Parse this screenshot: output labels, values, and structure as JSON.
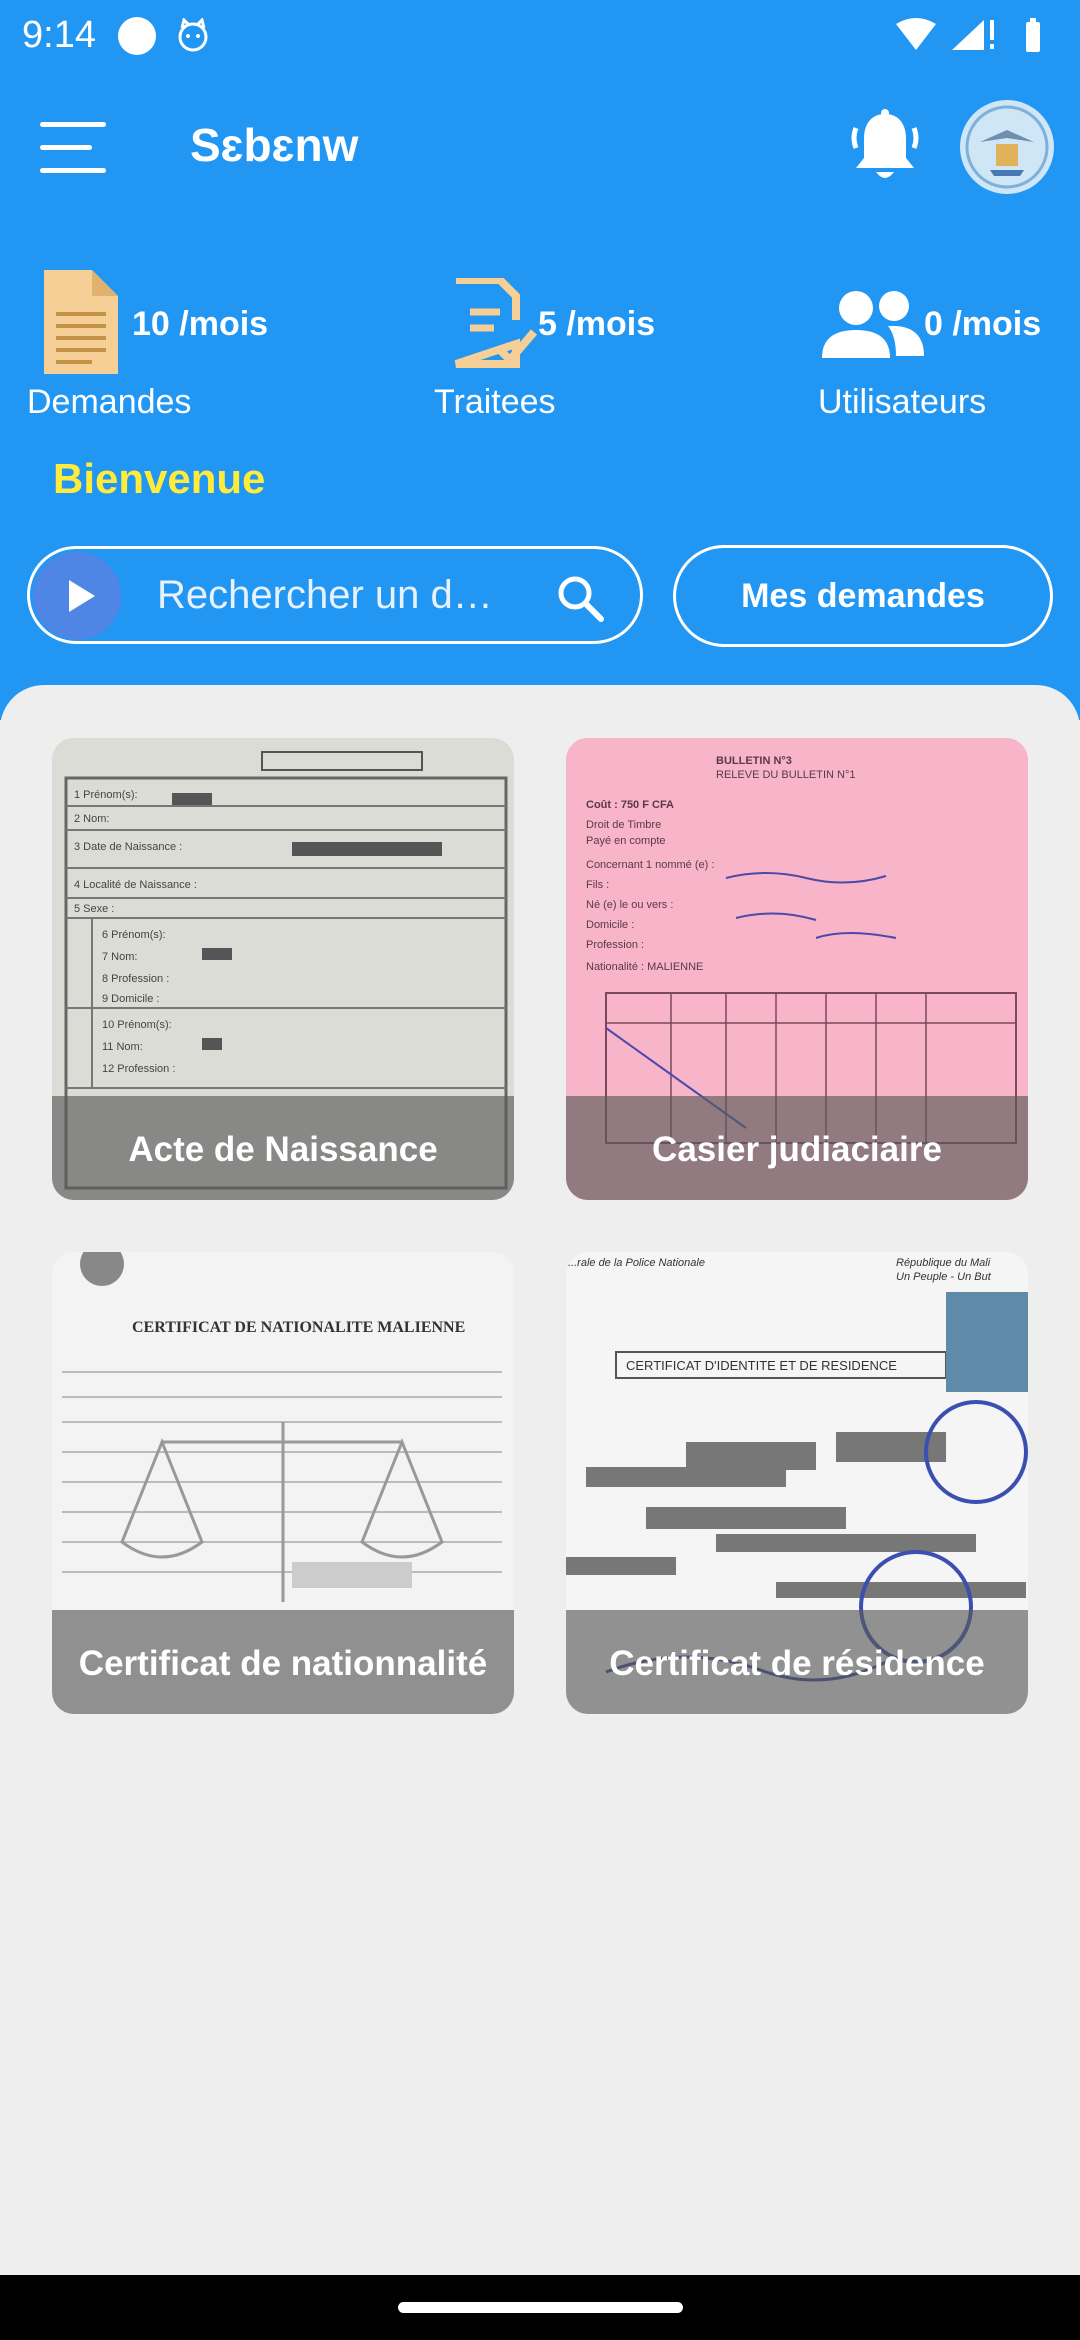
{
  "status_bar": {
    "time": "9:14"
  },
  "toolbar": {
    "title": "Sɛbɛnw"
  },
  "stats": [
    {
      "count": "10 /mois",
      "label": "Demandes"
    },
    {
      "count": "5 /mois",
      "label": "Traitees"
    },
    {
      "count": "0 /mois",
      "label": "Utilisateurs"
    }
  ],
  "welcome": "Bienvenue",
  "search": {
    "placeholder": "Rechercher un d…"
  },
  "my_requests_button": "Mes demandes",
  "documents": [
    {
      "label": "Acte de Naissance",
      "tint": "#d8d8d2"
    },
    {
      "label": "Casier judiaciaire",
      "tint": "#f7b3c8"
    },
    {
      "label": "Certificat de nationnalité",
      "tint": "#f2f2f2"
    },
    {
      "label": "Certificat de résidence",
      "tint": "#f4f4f4"
    }
  ],
  "colors": {
    "primary": "#2196f3",
    "accent_yellow": "#ffeb3b",
    "icon_orange": "#f5cf95"
  }
}
